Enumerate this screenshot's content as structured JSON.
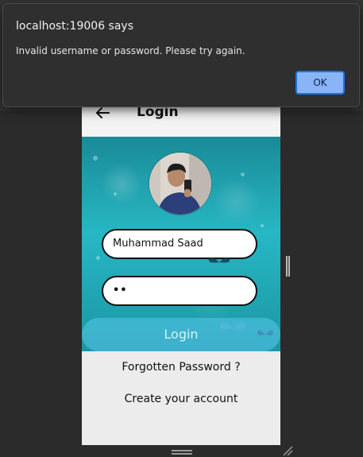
{
  "dialog": {
    "title": "localhost:19006 says",
    "message": "Invalid username or password. Please try again.",
    "ok_label": "OK"
  },
  "app": {
    "title": "Login",
    "username_value": "Muhammad Saad",
    "password_value": "••",
    "login_label": "Login",
    "forgot_label": "Forgotten Password ?",
    "create_label": "Create your account"
  },
  "icons": {
    "back": "back-arrow-icon",
    "resize": "resize-handle-icon"
  },
  "colors": {
    "ok_button": "#8ab4f8",
    "hero_teal": "#27b7c4",
    "dialog_bg": "#2f2f2f"
  }
}
